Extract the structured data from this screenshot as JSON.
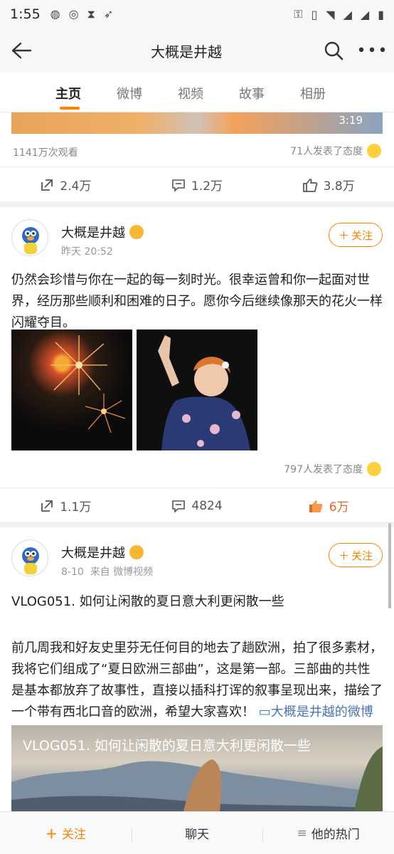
{
  "status_bar": {
    "time": "1:55"
  },
  "header": {
    "title": "大概是井越"
  },
  "tabs": [
    {
      "label": "主页",
      "active": true
    },
    {
      "label": "微博"
    },
    {
      "label": "视频"
    },
    {
      "label": "故事"
    },
    {
      "label": "相册"
    }
  ],
  "post1": {
    "duration": "3:19",
    "views": "1141万次观看",
    "attitude": "71人发表了态度",
    "repost": "2.4万",
    "comment": "1.2万",
    "like": "3.8万"
  },
  "post2": {
    "author": "大概是井越",
    "time": "昨天 20:52",
    "follow": "关注",
    "text": "仍然会珍惜与你在一起的每一刻时光。很幸运曾和你一起面对世界，经历那些顺利和困难的日子。愿你今后继续像那天的花火一样闪耀夺目。",
    "attitude": "797人发表了态度",
    "repost": "1.1万",
    "comment": "4824",
    "like": "6万"
  },
  "post3": {
    "author": "大概是井越",
    "time": "8-10",
    "source": "来自 微博视频",
    "follow": "关注",
    "title": "VLOG051. 如何让闲散的夏日意大利更闲散一些",
    "text": "前几周我和好友史里芬无任何目的地去了趟欧洲，拍了很多素材，我将它们组成了“夏日欧洲三部曲”，这是第一部。三部曲的共性是基本都放弃了故事性，直接以插科打诨的叙事呈现出来，描绘了一个带有西北口音的欧洲，希望大家喜欢！",
    "video_link": "大概是井越的微博视频",
    "video_title": "VLOG051. 如何让闲散的夏日意大利更闲散一些"
  },
  "bottom_bar": {
    "follow": "关注",
    "chat": "聊天",
    "hot": "他的热门"
  },
  "colors": {
    "accent": "#ff8200",
    "link": "#4a74b5",
    "liked": "#e8652a"
  }
}
